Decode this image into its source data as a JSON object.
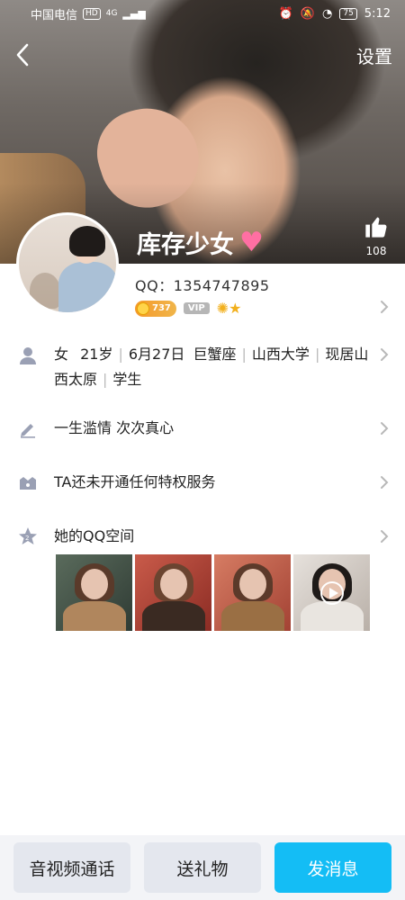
{
  "status_bar": {
    "carrier": "中国电信",
    "hd": "HD",
    "network": "4G",
    "battery": "75",
    "time": "5:12"
  },
  "nav": {
    "settings_label": "设置"
  },
  "profile": {
    "nickname": "库存少女",
    "qq_label": "QQ：",
    "qq_number": "1354747895",
    "level_value": "737",
    "vip_label": "VIP",
    "like_count": "108"
  },
  "info_rows": {
    "basic": {
      "segments": [
        "女",
        "21岁",
        "6月27日",
        "巨蟹座",
        "山西大学",
        "现居山西太原",
        "学生"
      ]
    },
    "signature": "一生滥情 次次真心",
    "privilege": "TA还未开通任何特权服务",
    "qzone": "她的QQ空间"
  },
  "bottom_bar": {
    "call_label": "音视频通话",
    "gift_label": "送礼物",
    "message_label": "发消息"
  },
  "colors": {
    "accent": "#14bdf5",
    "heart": "#ff6fa3",
    "level_badge": "#f59a2b",
    "icon_gray": "#9aa0b4"
  }
}
